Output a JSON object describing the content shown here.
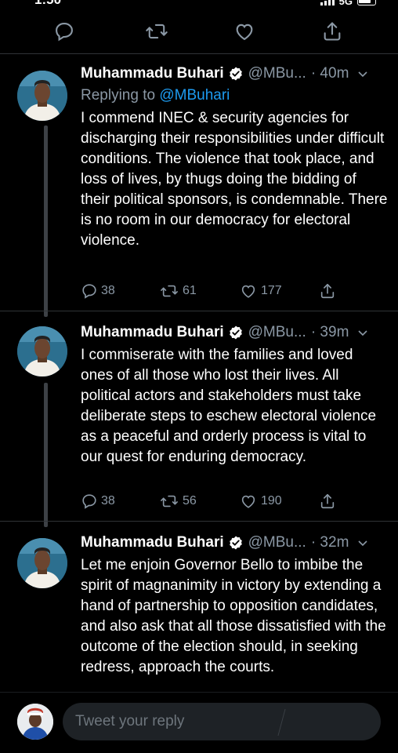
{
  "status": {
    "time": "1:50",
    "network": "5G"
  },
  "tweets": [
    {
      "name": "Muhammadu Buhari",
      "handle": "@MBu...",
      "time": "· 40m",
      "reply_prefix": "Replying to ",
      "reply_handle": "@MBuhari",
      "text": "I commend INEC & security agencies for discharging their responsibilities under difficult conditions. The violence that took place, and loss of lives, by thugs doing the bidding of their political sponsors, is condemnable. There is no room in our democracy for electoral violence.",
      "replies": "38",
      "retweets": "61",
      "likes": "177"
    },
    {
      "name": "Muhammadu Buhari",
      "handle": "@MBu...",
      "time": "· 39m",
      "text": "I commiserate with the families and loved ones of all those who lost their lives. All political actors and stakeholders must take deliberate steps to eschew electoral violence as a peaceful and orderly process is vital to our quest for enduring democracy.",
      "replies": "38",
      "retweets": "56",
      "likes": "190"
    },
    {
      "name": "Muhammadu Buhari",
      "handle": "@MBu...",
      "time": "· 32m",
      "text": "Let me enjoin Governor Bello to imbibe the spirit of magnanimity in victory by extending a hand of partnership to opposition candidates, and also ask that all those dissatisfied with the outcome of the election should, in seeking redress, approach the courts."
    }
  ],
  "reply_bar": {
    "placeholder": "Tweet your reply"
  },
  "colors": {
    "background": "#000000",
    "secondary_text": "#8b98a5",
    "link": "#1d9bf0",
    "divider": "#2f3336"
  }
}
